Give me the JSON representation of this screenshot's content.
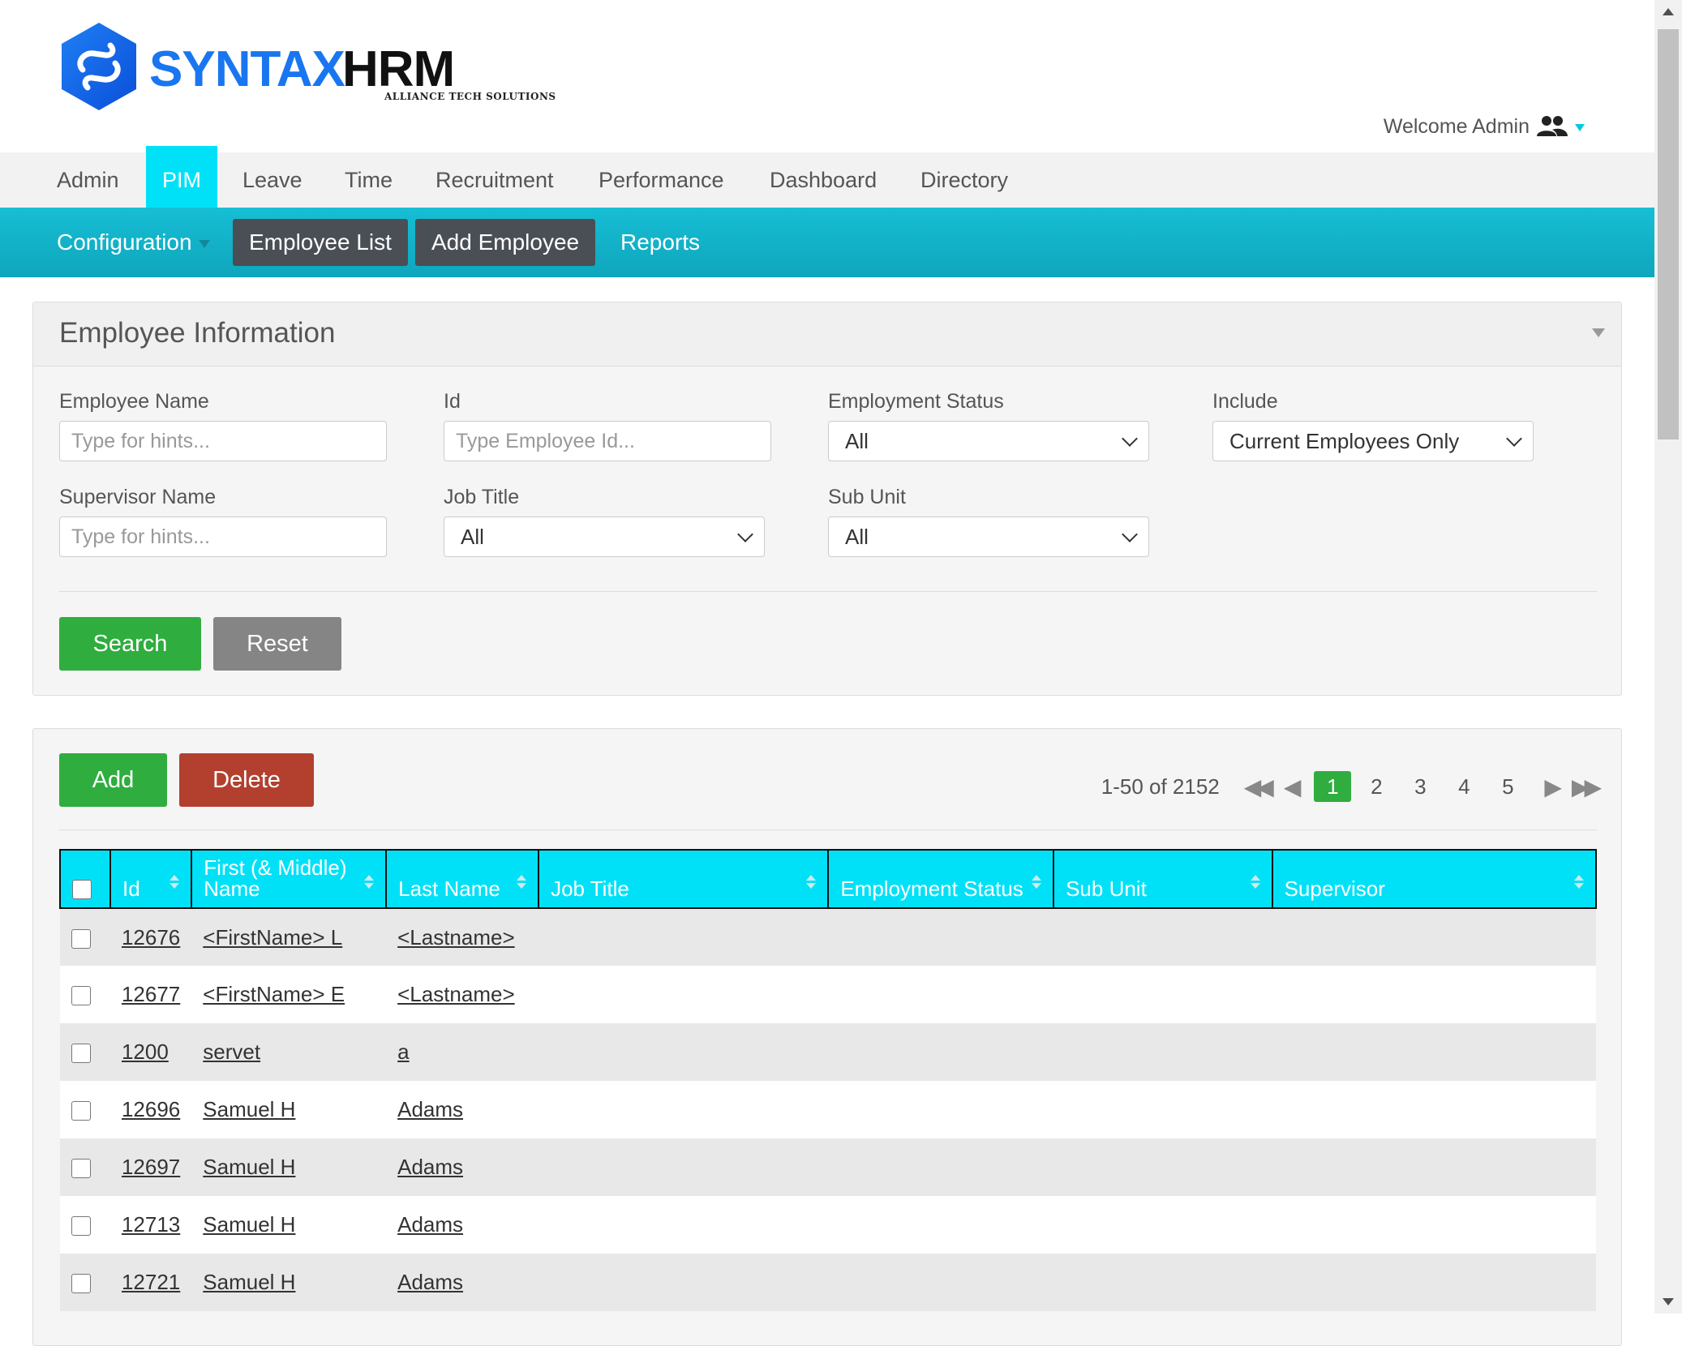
{
  "brand": {
    "name_part1": "SYNTAX",
    "name_part2": "HRM",
    "tagline": "ALLIANCE TECH SOLUTIONS",
    "logo_color": "#1976f0"
  },
  "header": {
    "welcome": "Welcome Admin",
    "user_icon": "users-icon"
  },
  "main_nav": {
    "items": [
      "Admin",
      "PIM",
      "Leave",
      "Time",
      "Recruitment",
      "Performance",
      "Dashboard",
      "Directory"
    ],
    "active": "PIM",
    "active_color": "#00e1f8"
  },
  "sub_nav": {
    "configuration": "Configuration",
    "employee_list": "Employee List",
    "add_employee": "Add Employee",
    "reports": "Reports"
  },
  "search_panel": {
    "title": "Employee Information",
    "employee_name": {
      "label": "Employee Name",
      "placeholder": "Type for hints..."
    },
    "id": {
      "label": "Id",
      "placeholder": "Type Employee Id..."
    },
    "employment_status": {
      "label": "Employment Status",
      "value": "All"
    },
    "include": {
      "label": "Include",
      "value": "Current Employees Only"
    },
    "supervisor_name": {
      "label": "Supervisor Name",
      "placeholder": "Type for hints..."
    },
    "job_title": {
      "label": "Job Title",
      "value": "All"
    },
    "sub_unit": {
      "label": "Sub Unit",
      "value": "All"
    },
    "search_button": "Search",
    "reset_button": "Reset"
  },
  "results": {
    "add_button": "Add",
    "delete_button": "Delete",
    "range_text": "1-50 of 2152",
    "pages": [
      "1",
      "2",
      "3",
      "4",
      "5"
    ],
    "current_page": "1",
    "columns": {
      "id": "Id",
      "first_middle_name": "First (& Middle) Name",
      "last_name": "Last Name",
      "job_title": "Job Title",
      "employment_status": "Employment Status",
      "sub_unit": "Sub Unit",
      "supervisor": "Supervisor"
    },
    "rows": [
      {
        "id": "12676",
        "first": "<FirstName> L",
        "last": "<Lastname>"
      },
      {
        "id": "12677",
        "first": "<FirstName> E",
        "last": "<Lastname>"
      },
      {
        "id": "1200",
        "first": "servet",
        "last": "a"
      },
      {
        "id": "12696",
        "first": "Samuel H",
        "last": "Adams"
      },
      {
        "id": "12697",
        "first": "Samuel H",
        "last": "Adams"
      },
      {
        "id": "12713",
        "first": "Samuel H",
        "last": "Adams"
      },
      {
        "id": "12721",
        "first": "Samuel H",
        "last": "Adams"
      }
    ]
  },
  "colors": {
    "teal_bar": "#0ea6bd",
    "search_green": "#2fad3f",
    "delete_red": "#b3402f",
    "reset_gray": "#858585",
    "table_header": "#00e1f8"
  }
}
